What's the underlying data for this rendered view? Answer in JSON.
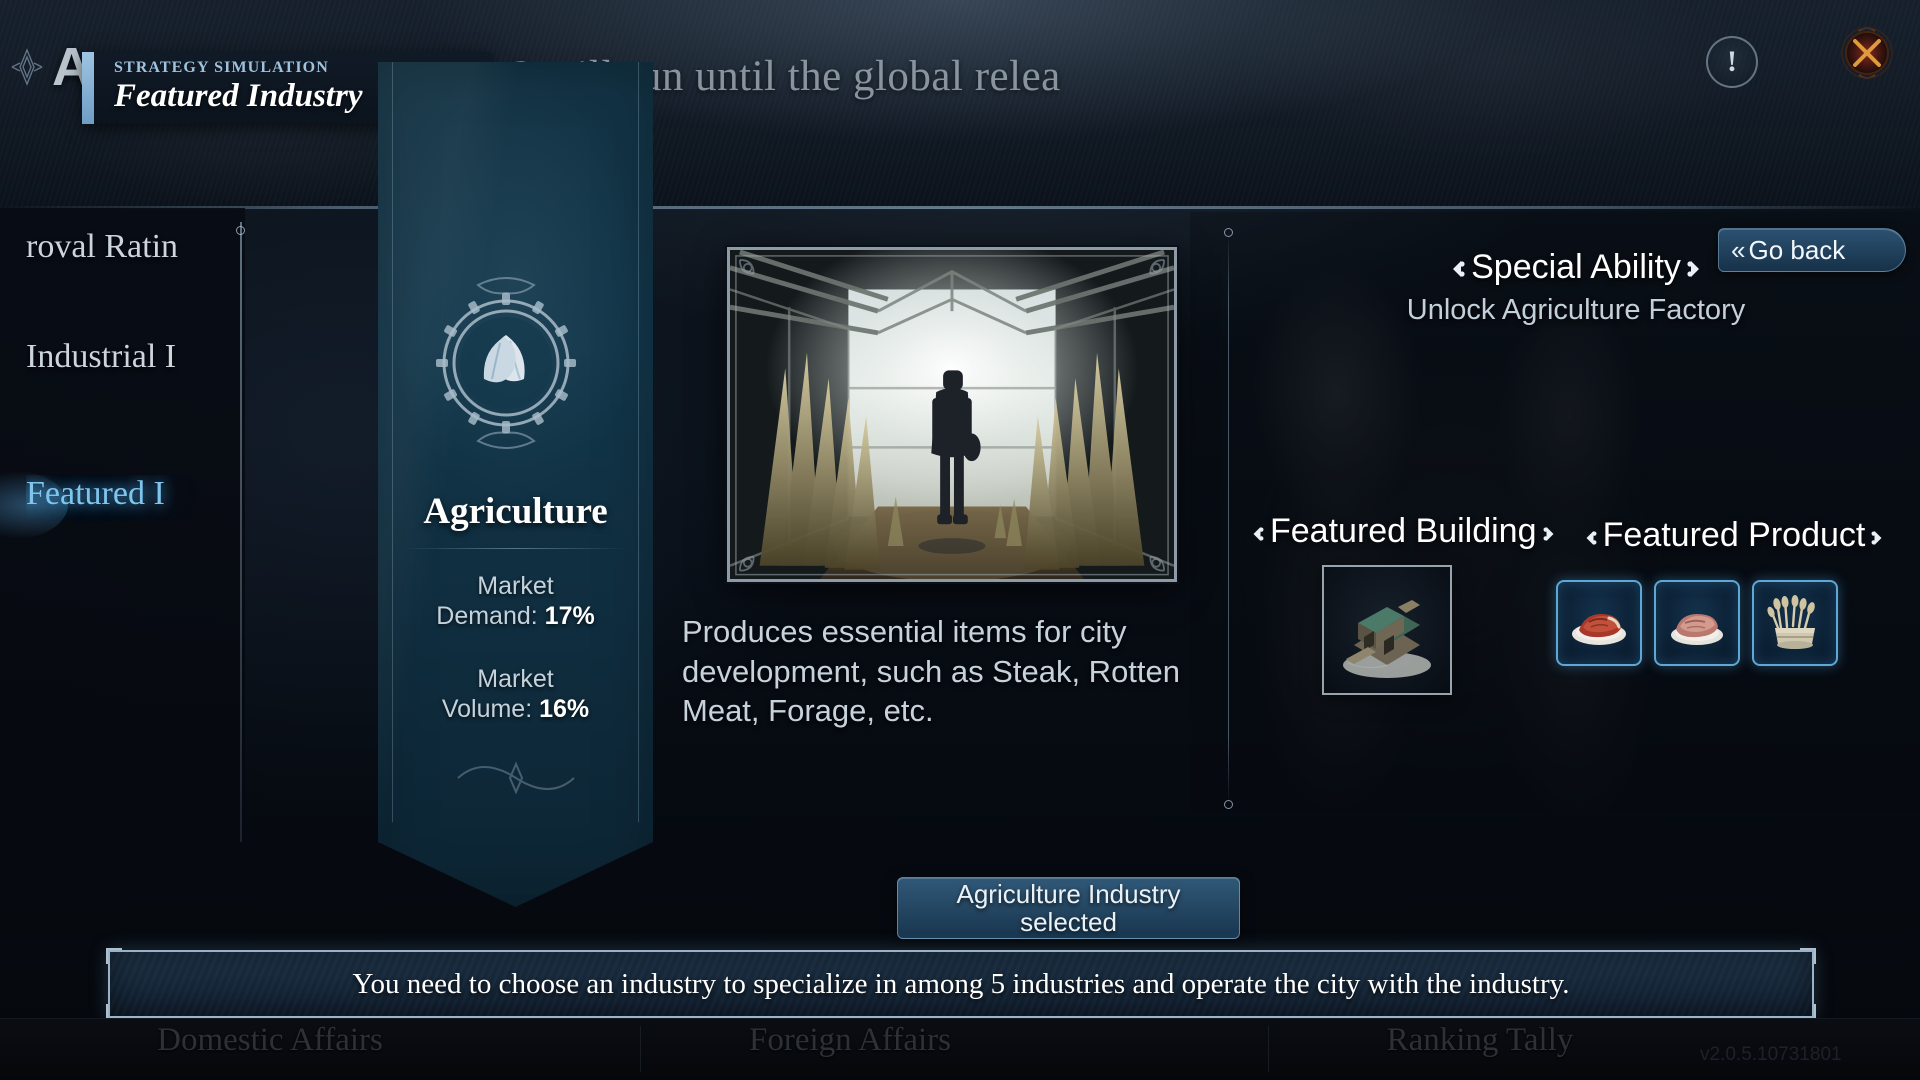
{
  "window": {
    "background_headline": "eason 2 will run until the global relea",
    "bg_letter": "A",
    "version": "v2.0.5.10731801"
  },
  "header": {
    "kicker": "STRATEGY SIMULATION",
    "title": "Featured Industry",
    "info_icon": "exclamation-icon",
    "close_icon": "close-x-icon"
  },
  "sidebar": {
    "items": [
      {
        "label": "roval Ratin",
        "active": false
      },
      {
        "label": "Industrial I",
        "active": false
      },
      {
        "label": "Featured I",
        "active": true
      }
    ]
  },
  "industry_banner": {
    "emblem_icon": "leaf-gear-emblem-icon",
    "name": "Agriculture",
    "stats": [
      {
        "label": "Market",
        "label2": "Demand:",
        "value": "17%"
      },
      {
        "label": "Market",
        "label2": "Volume:",
        "value": "16%"
      }
    ]
  },
  "main": {
    "hero_image_alt": "greenhouse-interior-artwork",
    "description": "Produces essential items for city development, such as Steak, Rotten Meat, Forage, etc."
  },
  "right_panel": {
    "special_ability_title": "Special Ability",
    "special_ability_value": "Unlock Agriculture Factory",
    "featured_building_title": "Featured Building",
    "featured_product_title": "Featured Product",
    "go_back_label": "Go back",
    "go_back_chevron": "«",
    "building": {
      "name": "agriculture-farm-building-icon"
    },
    "products": [
      {
        "name": "steak-icon"
      },
      {
        "name": "rotten-meat-icon"
      },
      {
        "name": "forage-icon"
      }
    ]
  },
  "footer": {
    "selected_button_line1": "Agriculture Industry",
    "selected_button_line2": "selected",
    "tooltip": "You need to choose an industry to specialize in among 5 industries and operate the city with the industry.",
    "nav": [
      {
        "label": "Domestic Affairs"
      },
      {
        "label": "Foreign Affairs"
      },
      {
        "label": "Ranking Tally"
      }
    ]
  },
  "colors": {
    "accent_blue": "#7fc6ef",
    "banner_teal": "#12364a",
    "frame_silver": "#97a3ad",
    "close_red": "#c0392b"
  }
}
